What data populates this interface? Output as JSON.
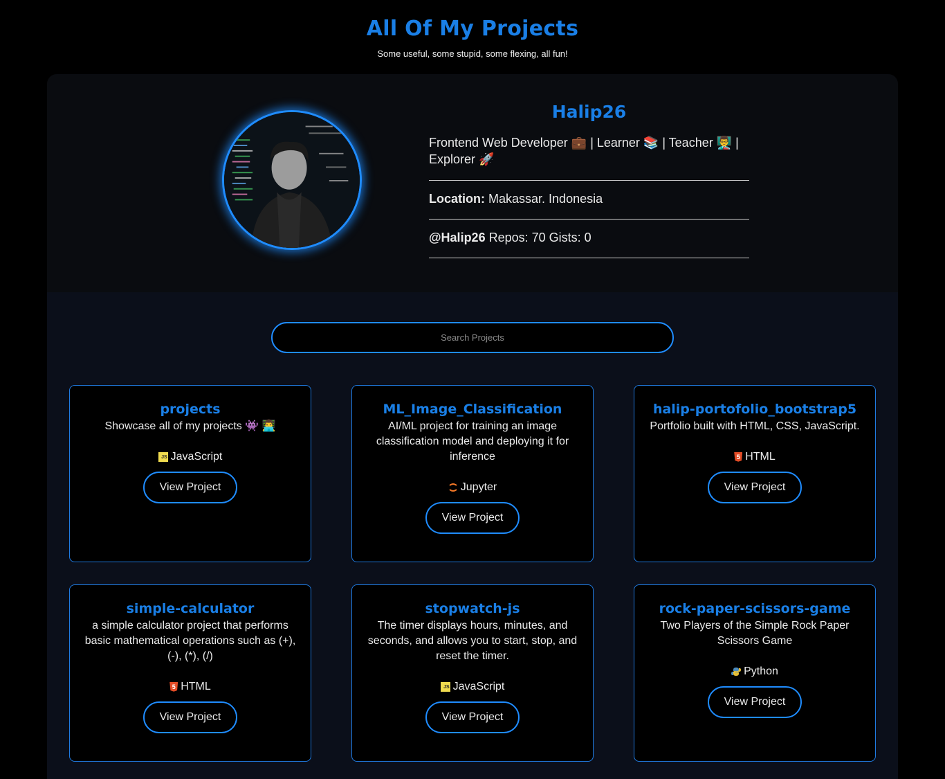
{
  "header": {
    "title": "All Of My Projects",
    "subtitle": "Some useful, some stupid, some flexing, all fun!"
  },
  "profile": {
    "name": "Halip26",
    "bio": "Frontend Web Developer 💼 | Learner 📚 | Teacher 👨‍🏫 | Explorer 🚀",
    "location_label": "Location:",
    "location_value": "Makassar. Indonesia",
    "handle": "@Halip26",
    "stats": "Repos: 70 Gists: 0"
  },
  "search": {
    "placeholder": "Search Projects"
  },
  "colors": {
    "accent": "#1f8cff",
    "title_blue": "#1a7fe6",
    "background": "#000000"
  },
  "projects": [
    {
      "title": "projects",
      "description": "Showcase all of my projects 👾 👨‍💻",
      "language": "JavaScript",
      "language_icon": "javascript-icon",
      "button": "View Project"
    },
    {
      "title": "ML_Image_Classification",
      "description": "AI/ML project for training an image classification model and deploying it for inference",
      "language": "Jupyter",
      "language_icon": "jupyter-icon",
      "button": "View Project"
    },
    {
      "title": "halip-portofolio_bootstrap5",
      "description": "Portfolio built with HTML, CSS, JavaScript.",
      "language": "HTML",
      "language_icon": "html5-icon",
      "button": "View Project"
    },
    {
      "title": "simple-calculator",
      "description": "a simple calculator project that performs basic mathematical operations such as (+), (-), (*), (/)",
      "language": "HTML",
      "language_icon": "html5-icon",
      "button": "View Project"
    },
    {
      "title": "stopwatch-js",
      "description": "The timer displays hours, minutes, and seconds, and allows you to start, stop, and reset the timer.",
      "language": "JavaScript",
      "language_icon": "javascript-icon",
      "button": "View Project"
    },
    {
      "title": "rock-paper-scissors-game",
      "description": "Two Players of the Simple Rock Paper Scissors Game",
      "language": "Python",
      "language_icon": "python-icon",
      "button": "View Project"
    }
  ]
}
